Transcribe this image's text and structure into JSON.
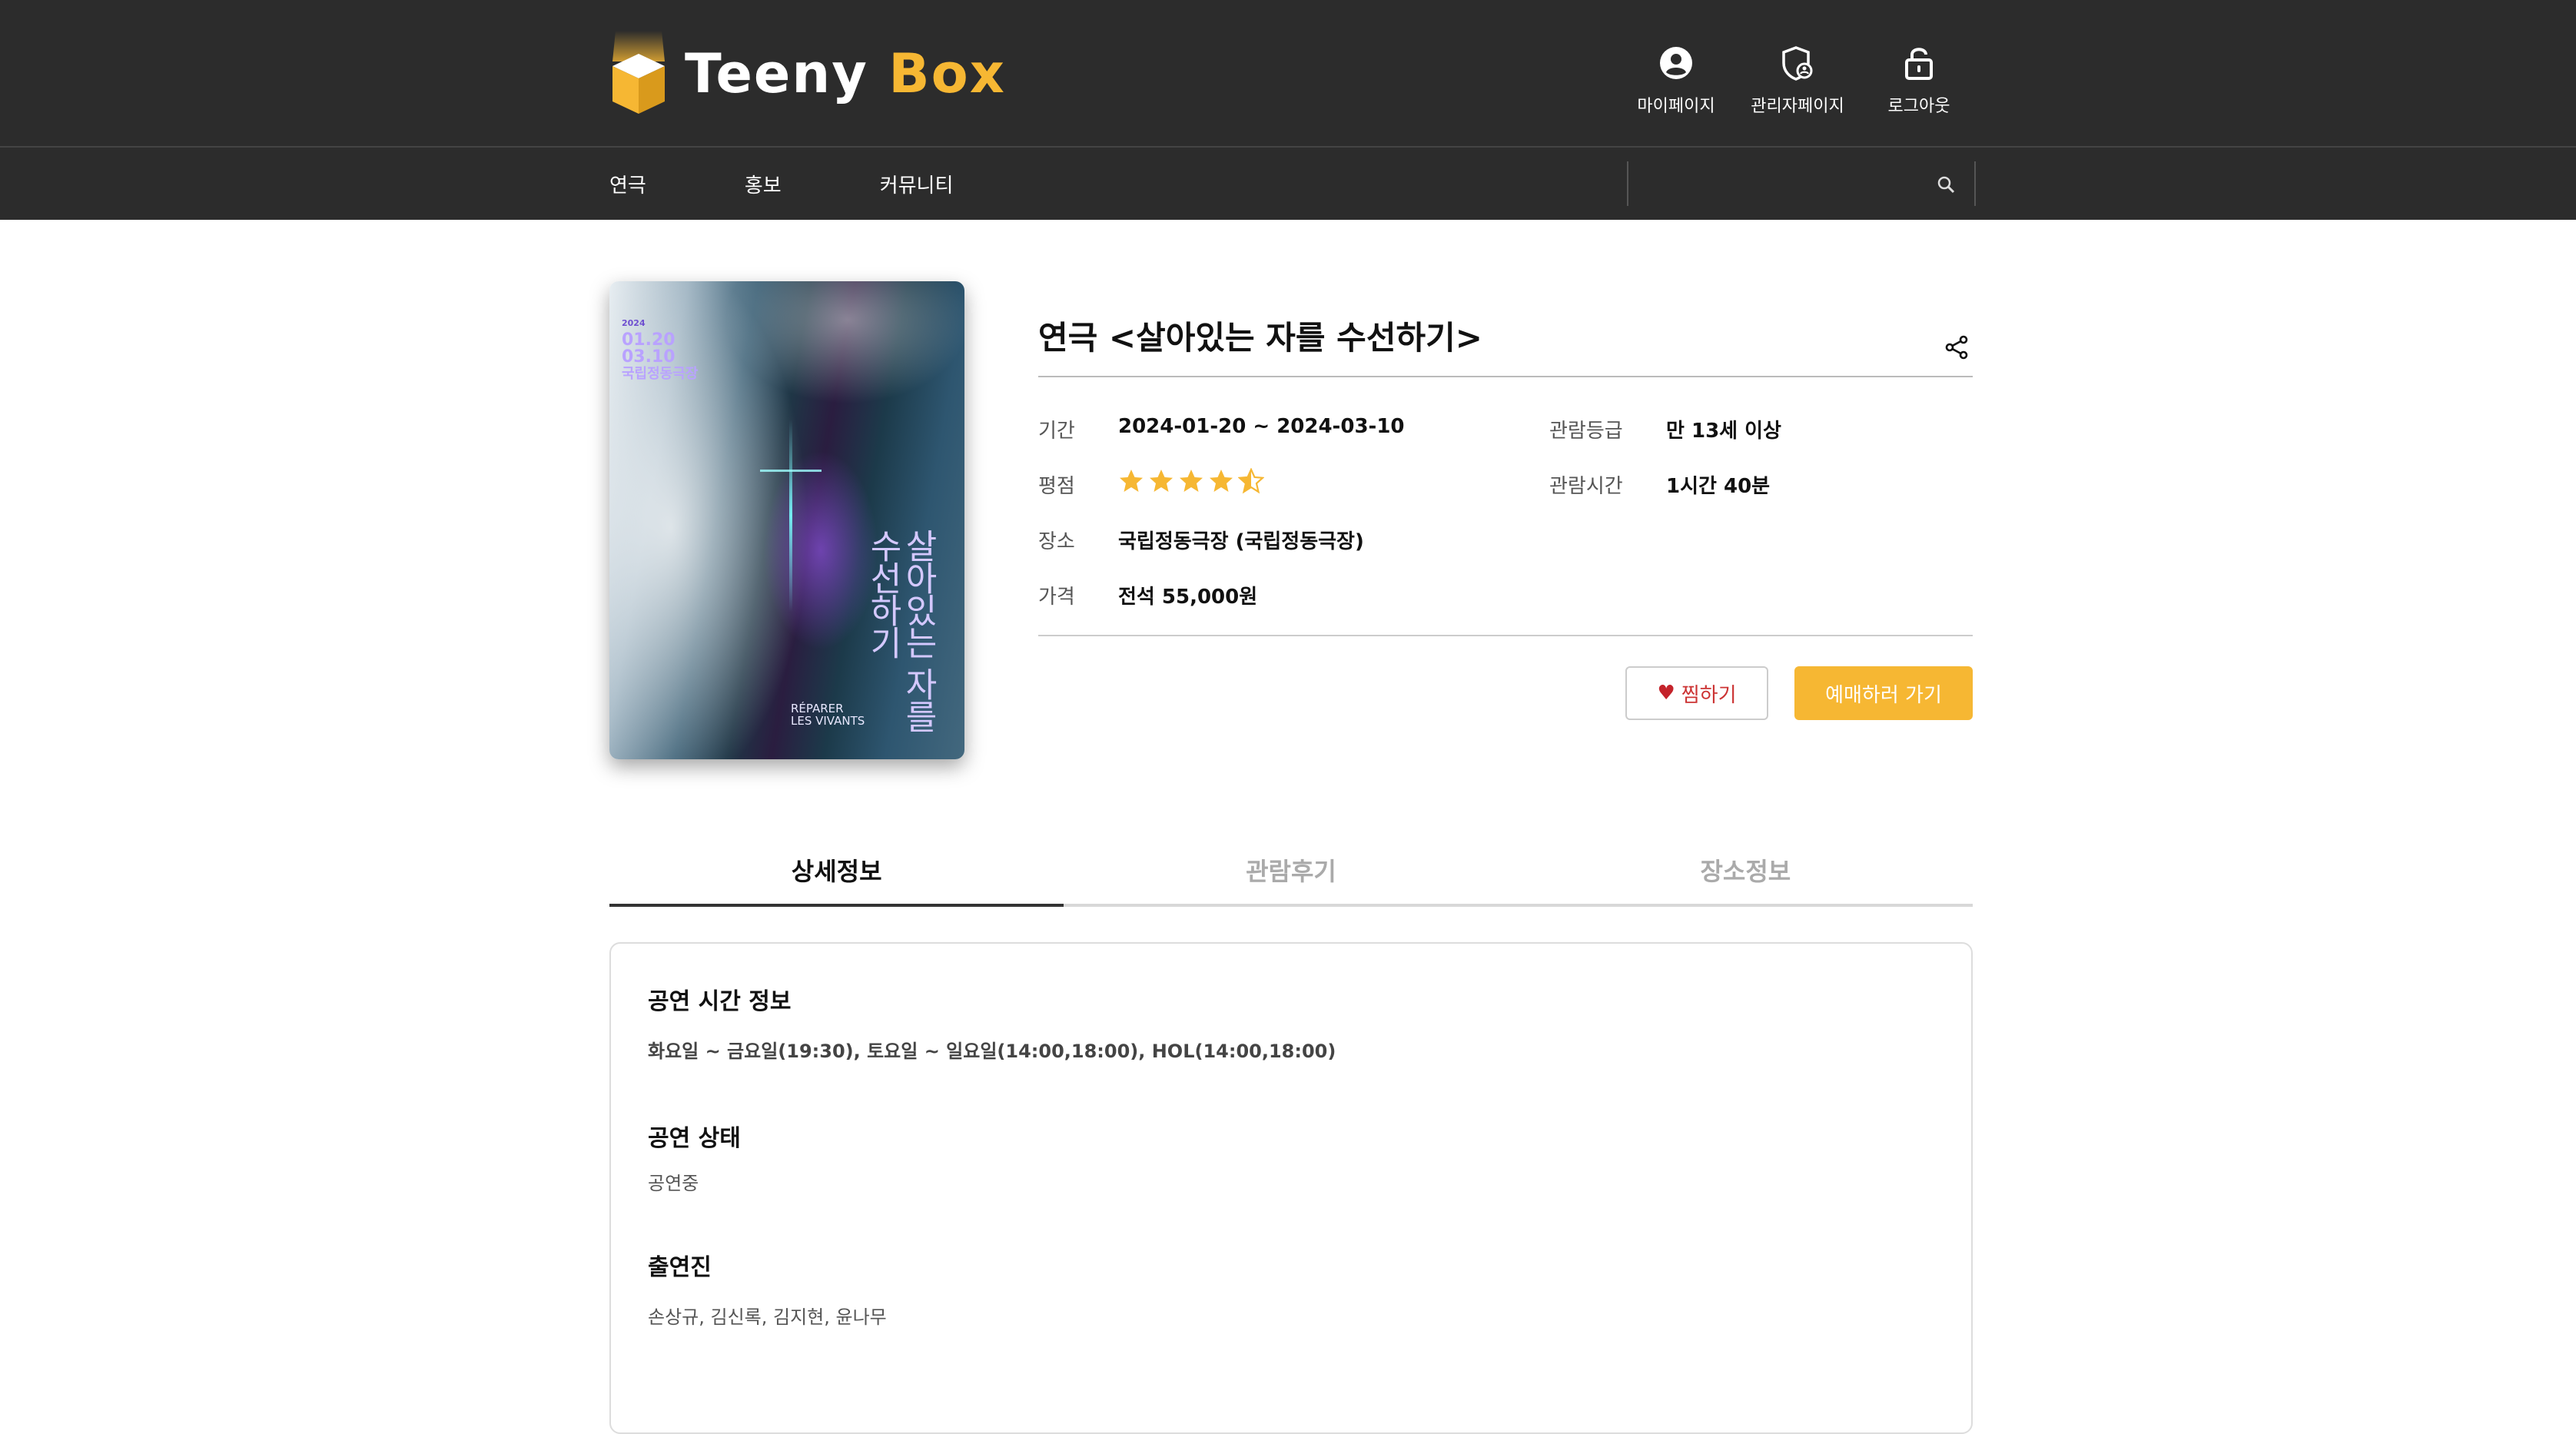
{
  "header": {
    "logo": {
      "teeny": "Teeny",
      "box": "Box"
    },
    "nav": [
      {
        "label": "마이페이지",
        "icon": "user-circle-icon"
      },
      {
        "label": "관리자페이지",
        "icon": "admin-shield-icon"
      },
      {
        "label": "로그아웃",
        "icon": "unlock-icon"
      }
    ]
  },
  "menu": {
    "items": [
      "연극",
      "홍보",
      "커뮤니티"
    ],
    "search_placeholder": ""
  },
  "poster": {
    "date_line1": "2024",
    "date_start": "01.20",
    "date_end": "03.10",
    "venue": "국립정동극장",
    "title_vertical": "살아있는 자를 수선하기",
    "title_en_1": "RÉPARER",
    "title_en_2": "LES VIVANTS"
  },
  "show": {
    "title": "연극 <살아있는 자를 수선하기>",
    "period_label": "기간",
    "period_value": "2024-01-20 ~ 2024-03-10",
    "rating_label": "평점",
    "rating_value": 4.5,
    "venue_label": "장소",
    "venue_value": "국립정동극장 (국립정동극장)",
    "price_label": "가격",
    "price_value": "전석 55,000원",
    "age_label": "관람등급",
    "age_value": "만 13세 이상",
    "runtime_label": "관람시간",
    "runtime_value": "1시간 40분"
  },
  "actions": {
    "like_label": "찜하기",
    "reserve_label": "예매하러 가기"
  },
  "tabs": [
    {
      "label": "상세정보",
      "active": true
    },
    {
      "label": "관람후기",
      "active": false
    },
    {
      "label": "장소정보",
      "active": false
    }
  ],
  "detail": {
    "time_title": "공연 시간 정보",
    "time_text": "화요일 ~ 금요일(19:30), 토요일 ~ 일요일(14:00,18:00), HOL(14:00,18:00)",
    "status_title": "공연 상태",
    "status_text": "공연중",
    "cast_title": "출연진",
    "cast_text": "손상규, 김신록, 김지현, 윤나무"
  },
  "colors": {
    "header_bg": "#2c2c2c",
    "accent": "#f6b733",
    "heart": "#c4232b"
  }
}
